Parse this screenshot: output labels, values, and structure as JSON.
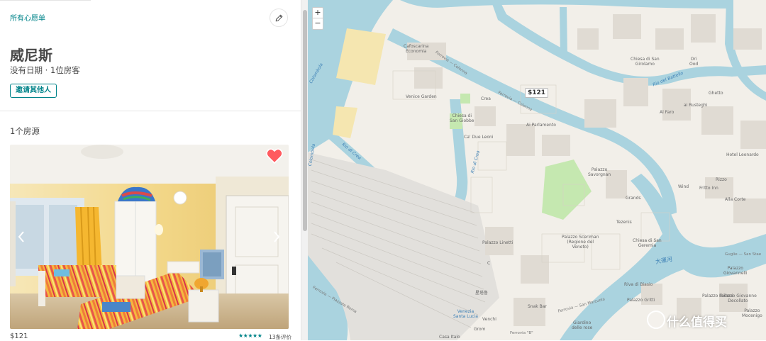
{
  "wishlist": {
    "breadcrumb": "所有心愿单",
    "title": "威尼斯",
    "subtitle": "没有日期 · 1位房客",
    "invite_label": "邀请其他人",
    "listing_count": "1个房源"
  },
  "listing": {
    "price": "$121",
    "stars": "★★★★★",
    "reviews": "13条评价",
    "heart_color": "#ff5a5f"
  },
  "map": {
    "zoom_in": "+",
    "zoom_out": "−",
    "price_marker": "$121",
    "labels": {
      "cafoscarina": "Cafoscarina\nEconomia",
      "ferrovia1": "Ferrovia — Colonna",
      "ferrovia2": "Ferrovia — Colonna",
      "chiesa_girolamo": "Chiesa di San\nGirolamo",
      "ori": "Ori\nOod",
      "rio_battello": "Rio del Battello",
      "ghetto": "Ghetto",
      "venice_garden": "Venice Garden",
      "crea": "Crea",
      "chiesa_giobbe": "Chiesa di\nSan Giobbe",
      "ca_due_leoni": "Ca' Due Leoni",
      "al_faro": "Al Faro",
      "ai_rusteghi": "ai Rusteghi",
      "ai_parlamento": "Ai Parlamento",
      "rio_crea": "Rio di Crea",
      "rio_crea2": "Rio di Crea",
      "colombola": "Colombola",
      "colombola2": "Colombola",
      "palazzo_savorgnan": "Palazzo\nSavorgnan",
      "hotel_leonardo": "Hotel Leonardo",
      "wind": "Wind",
      "fritto_inn": "Fritto Inn",
      "rizzo": "Rizzo",
      "alla_corte": "Alla Corte",
      "grands": "Grands",
      "tezenis": "Tezenis",
      "palazzo_linetti": "Palazzo Linetti",
      "palazzo_sceriman": "Palazzo Sceriman\n(Regione del\nVeneto)",
      "chiesa_geremia": "Chiesa di San\nGeremia",
      "guglie": "Guglie — San Stae",
      "grand_canal": "大運河",
      "piazzale_roma": "Ferrovia — Piazzale Roma",
      "star_glass": "星塔鲁",
      "venezia_sl": "Venezia\nSanta Lucia",
      "snak_bar": "Snak Bar",
      "venchi": "Venchi",
      "grom": "Grom",
      "casa_italo": "Casa Italo",
      "ferrovia_b": "Ferrovia \"B\"",
      "riva_biasio": "Riva di Biasio",
      "palazzo_gritti": "Palazzo Gritti",
      "giardino": "Giardino\ndelle rose",
      "ferrovia_marcuola": "Ferrovia — San Marcuola",
      "palazzo_giovannelli": "Palazzo\nGiovannelli",
      "palazzo_gidoni": "Palazzo Gidoni",
      "palazzo_decollato": "Palazzo Giovanne\nDecollato",
      "palazzo_mocenigo": "Palazzo\nMocenigo",
      "c": "C"
    },
    "watermark": "什么值得买"
  },
  "colors": {
    "teal": "#00848a",
    "water": "#aad3df",
    "land": "#f2efe9",
    "green": "#c5e8b0",
    "building": "#e0dbd3"
  }
}
